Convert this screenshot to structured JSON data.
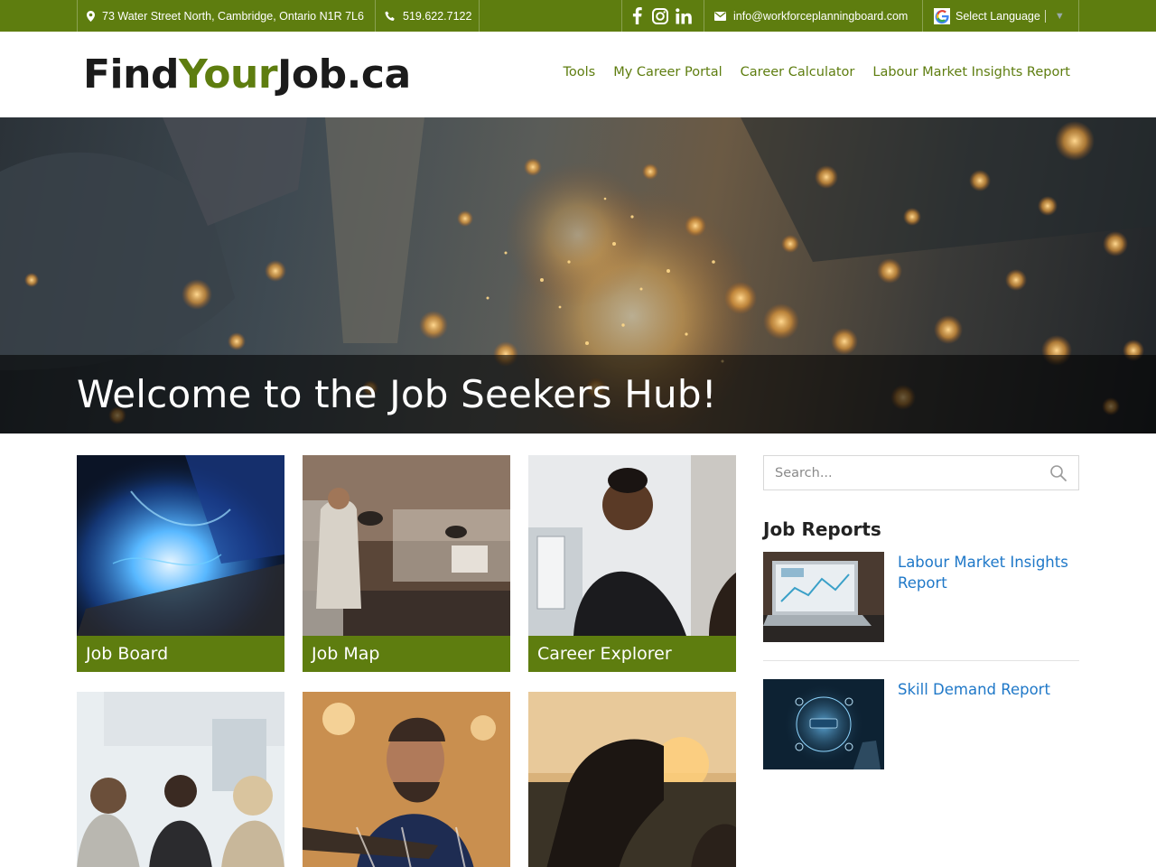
{
  "topbar": {
    "address": "73 Water Street North, Cambridge, Ontario N1R 7L6",
    "address_icon": "map-marker-icon",
    "phone": "519.622.7122",
    "phone_icon": "phone-icon",
    "social_icons": [
      "facebook-icon",
      "instagram-icon",
      "linkedin-icon"
    ],
    "email": "info@workforceplanningboard.com",
    "email_icon": "envelope-icon",
    "language_label": "Select Language",
    "language_icon": "google-icon"
  },
  "header": {
    "logo_part1": "Find",
    "logo_part2": "Your",
    "logo_part3": "Job.ca",
    "nav": [
      "Tools",
      "My Career Portal",
      "Career Calculator",
      "Labour Market Insights Report"
    ]
  },
  "hero": {
    "title": "Welcome to the Job Seekers Hub!"
  },
  "tiles": [
    {
      "label": "Job Board"
    },
    {
      "label": "Job Map"
    },
    {
      "label": "Career Explorer"
    },
    {
      "label": ""
    },
    {
      "label": ""
    },
    {
      "label": ""
    }
  ],
  "sidebar": {
    "search_placeholder": "Search...",
    "section_title": "Job Reports",
    "reports": [
      {
        "title": "Labour Market Insights Report"
      },
      {
        "title": "Skill Demand Report"
      }
    ]
  },
  "colors": {
    "brand_green": "#5e7d0f",
    "link_blue": "#1f78c8",
    "text_dark": "#1b1b1b"
  }
}
